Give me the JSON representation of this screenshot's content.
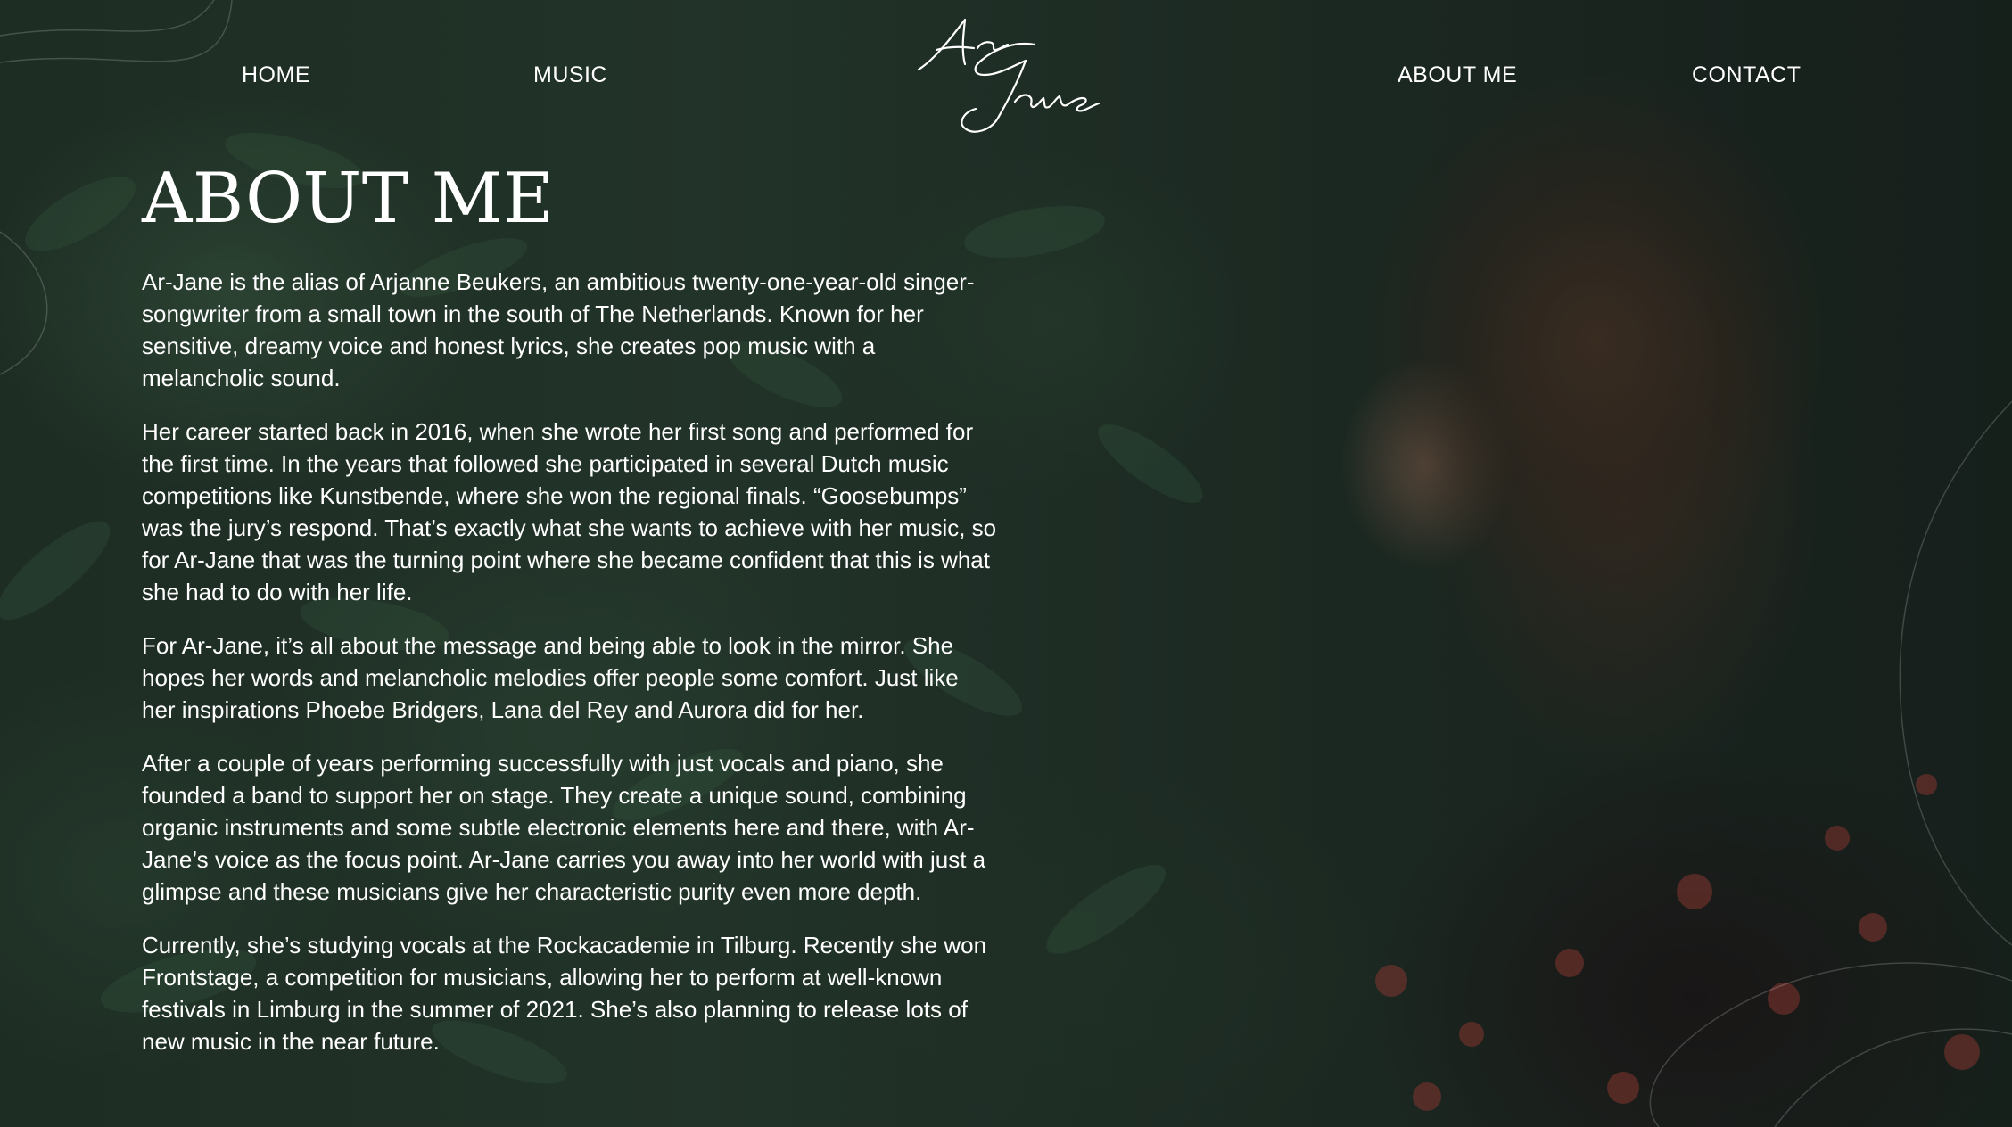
{
  "nav": {
    "home": "HOME",
    "music": "MUSIC",
    "about": "ABOUT ME",
    "contact": "CONTACT"
  },
  "logo": {
    "line1": "Ar",
    "line2": "Jane"
  },
  "about": {
    "title": "ABOUT ME",
    "paragraphs": [
      "Ar-Jane is the alias of Arjanne Beukers, an ambitious twenty-one-year-old singer-songwriter from a small town in the south of The Netherlands. Known for her sensitive, dreamy voice and honest lyrics, she creates pop music with a melancholic sound.",
      "Her career started back in 2016, when she wrote her first song and performed for the first time. In the years that followed she participated in several Dutch music competitions like Kunstbende, where she won the regional finals. “Goosebumps” was the jury’s respond. That’s exactly what she wants to achieve with her music, so for Ar-Jane that was the turning point where she became confident that this is what she had to do with her life.",
      "For Ar-Jane, it’s all about the message and being able to look in the mirror. She hopes her words and melancholic melodies offer people some comfort. Just like her inspirations Phoebe Bridgers, Lana del Rey and Aurora did for her.",
      "After a couple of years performing successfully with just vocals and piano, she founded a band to support her on stage. They create a unique sound, combining organic instruments and some subtle electronic elements here and there, with Ar-Jane’s voice as the focus point. Ar-Jane carries you away into her world with just a glimpse and these musicians give her characteristic purity even more depth.",
      "Currently, she’s studying vocals at the Rockacademie in Tilburg. Recently she won Frontstage, a competition for musicians, allowing her to perform at well-known festivals in Limburg in the summer of 2021. She’s also planning to release lots of new music in the near future."
    ]
  },
  "colors": {
    "text": "#ffffff",
    "background": "#1b2620",
    "accent_floral": "#b0413a"
  }
}
